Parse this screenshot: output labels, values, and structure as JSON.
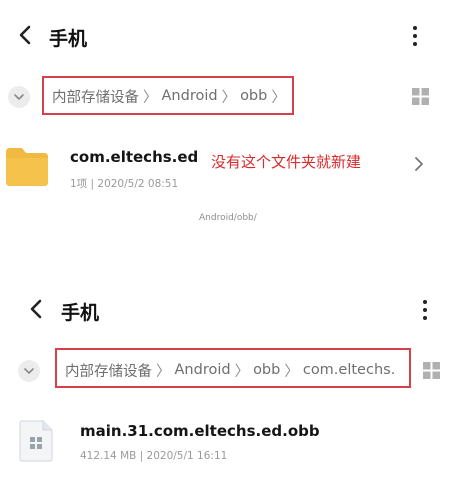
{
  "screen1": {
    "title": "手机",
    "breadcrumb": [
      "内部存储设备",
      "Android",
      "obb"
    ],
    "folder": {
      "name": "com.eltechs.ed",
      "meta": "1项 | 2020/5/2 08:51"
    },
    "annotation": "没有这个文件夹就新建",
    "path_caption": "Android/obb/"
  },
  "screen2": {
    "title": "手机",
    "breadcrumb": [
      "内部存储设备",
      "Android",
      "obb",
      "com.eltechs.e"
    ],
    "file": {
      "name": "main.31.com.eltechs.ed.obb",
      "meta": "412.14 MB | 2020/5/1 16:11"
    }
  },
  "colors": {
    "highlight_border": "#d4414b",
    "annotation_text": "#d92b2b",
    "folder_yellow": "#f5c34c"
  },
  "icons": [
    "back-arrow-icon",
    "more-vertical-icon",
    "chevron-down-icon",
    "grid-view-icon",
    "folder-icon",
    "chevron-right-icon",
    "file-icon"
  ]
}
